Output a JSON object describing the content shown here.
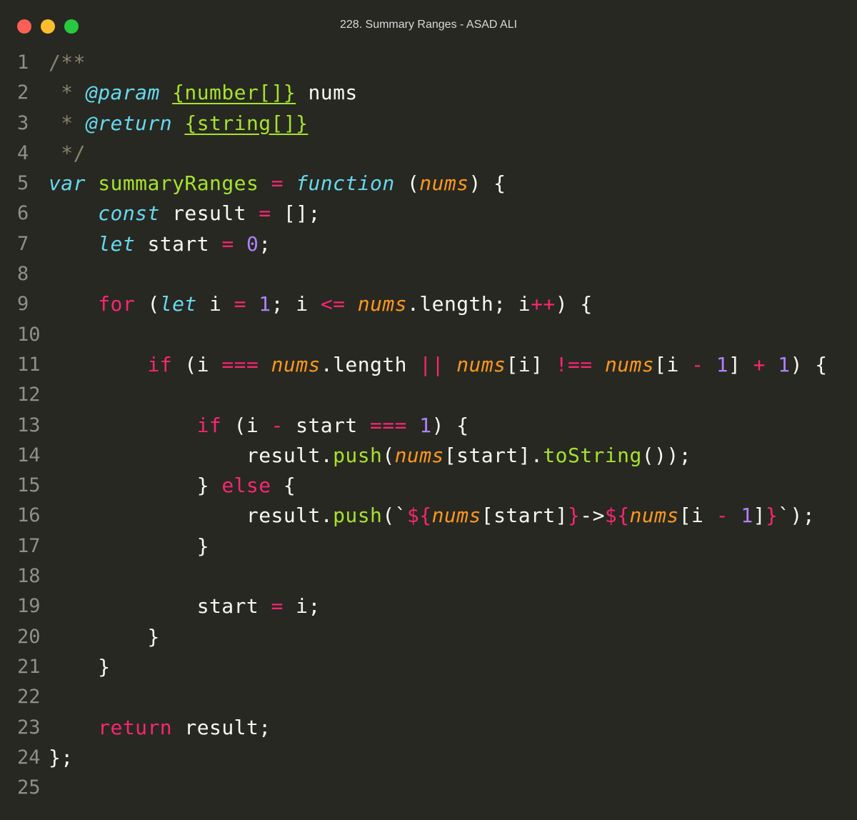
{
  "window": {
    "title": "228. Summary Ranges - ASAD ALI",
    "controls": [
      "close",
      "minimize",
      "maximize"
    ]
  },
  "colors": {
    "background": "#272822",
    "close": "#ff5f56",
    "minimize": "#ffbd2e",
    "maximize": "#27c93f"
  },
  "editor": {
    "language": "javascript",
    "lines": [
      {
        "n": "1",
        "tokens": [
          [
            "comment",
            "/**"
          ]
        ]
      },
      {
        "n": "2",
        "tokens": [
          [
            "comment",
            " * "
          ],
          [
            "tag",
            "@param"
          ],
          [
            "plain",
            " "
          ],
          [
            "type",
            "{number[]}"
          ],
          [
            "plain",
            " nums"
          ]
        ]
      },
      {
        "n": "3",
        "tokens": [
          [
            "comment",
            " * "
          ],
          [
            "tag",
            "@return"
          ],
          [
            "plain",
            " "
          ],
          [
            "type",
            "{string[]}"
          ]
        ]
      },
      {
        "n": "4",
        "tokens": [
          [
            "comment",
            " */"
          ]
        ]
      },
      {
        "n": "5",
        "tokens": [
          [
            "storage",
            "var"
          ],
          [
            "plain",
            " "
          ],
          [
            "func",
            "summaryRanges"
          ],
          [
            "plain",
            " "
          ],
          [
            "op",
            "="
          ],
          [
            "plain",
            " "
          ],
          [
            "storage",
            "function"
          ],
          [
            "plain",
            " ("
          ],
          [
            "param",
            "nums"
          ],
          [
            "plain",
            ") {"
          ]
        ]
      },
      {
        "n": "6",
        "tokens": [
          [
            "plain",
            "    "
          ],
          [
            "storage",
            "const"
          ],
          [
            "plain",
            " result "
          ],
          [
            "op",
            "="
          ],
          [
            "plain",
            " [];"
          ]
        ]
      },
      {
        "n": "7",
        "tokens": [
          [
            "plain",
            "    "
          ],
          [
            "storage",
            "let"
          ],
          [
            "plain",
            " start "
          ],
          [
            "op",
            "="
          ],
          [
            "plain",
            " "
          ],
          [
            "num",
            "0"
          ],
          [
            "plain",
            ";"
          ]
        ]
      },
      {
        "n": "8",
        "tokens": []
      },
      {
        "n": "9",
        "tokens": [
          [
            "plain",
            "    "
          ],
          [
            "kw",
            "for"
          ],
          [
            "plain",
            " ("
          ],
          [
            "storage",
            "let"
          ],
          [
            "plain",
            " i "
          ],
          [
            "op",
            "="
          ],
          [
            "plain",
            " "
          ],
          [
            "num",
            "1"
          ],
          [
            "plain",
            "; i "
          ],
          [
            "op",
            "<="
          ],
          [
            "plain",
            " "
          ],
          [
            "param",
            "nums"
          ],
          [
            "plain",
            ".length; i"
          ],
          [
            "op",
            "++"
          ],
          [
            "plain",
            ") {"
          ]
        ]
      },
      {
        "n": "10",
        "tokens": []
      },
      {
        "n": "11",
        "tokens": [
          [
            "plain",
            "        "
          ],
          [
            "kw",
            "if"
          ],
          [
            "plain",
            " (i "
          ],
          [
            "op",
            "==="
          ],
          [
            "plain",
            " "
          ],
          [
            "param",
            "nums"
          ],
          [
            "plain",
            ".length "
          ],
          [
            "op",
            "||"
          ],
          [
            "plain",
            " "
          ],
          [
            "param",
            "nums"
          ],
          [
            "plain",
            "[i] "
          ],
          [
            "op",
            "!=="
          ],
          [
            "plain",
            " "
          ],
          [
            "param",
            "nums"
          ],
          [
            "plain",
            "[i "
          ],
          [
            "op",
            "-"
          ],
          [
            "plain",
            " "
          ],
          [
            "num",
            "1"
          ],
          [
            "plain",
            "] "
          ],
          [
            "op",
            "+"
          ],
          [
            "plain",
            " "
          ],
          [
            "num",
            "1"
          ],
          [
            "plain",
            ") {"
          ]
        ]
      },
      {
        "n": "12",
        "tokens": []
      },
      {
        "n": "13",
        "tokens": [
          [
            "plain",
            "            "
          ],
          [
            "kw",
            "if"
          ],
          [
            "plain",
            " (i "
          ],
          [
            "op",
            "-"
          ],
          [
            "plain",
            " start "
          ],
          [
            "op",
            "==="
          ],
          [
            "plain",
            " "
          ],
          [
            "num",
            "1"
          ],
          [
            "plain",
            ") {"
          ]
        ]
      },
      {
        "n": "14",
        "tokens": [
          [
            "plain",
            "                result."
          ],
          [
            "func",
            "push"
          ],
          [
            "plain",
            "("
          ],
          [
            "param",
            "nums"
          ],
          [
            "plain",
            "[start]."
          ],
          [
            "func",
            "toString"
          ],
          [
            "plain",
            "());"
          ]
        ]
      },
      {
        "n": "15",
        "tokens": [
          [
            "plain",
            "            } "
          ],
          [
            "kw",
            "else"
          ],
          [
            "plain",
            " {"
          ]
        ]
      },
      {
        "n": "16",
        "tokens": [
          [
            "plain",
            "                result."
          ],
          [
            "func",
            "push"
          ],
          [
            "plain",
            "(`"
          ],
          [
            "op",
            "${"
          ],
          [
            "param",
            "nums"
          ],
          [
            "plain",
            "[start]"
          ],
          [
            "op",
            "}"
          ],
          [
            "plain",
            "->"
          ],
          [
            "op",
            "${"
          ],
          [
            "param",
            "nums"
          ],
          [
            "plain",
            "[i "
          ],
          [
            "op",
            "-"
          ],
          [
            "plain",
            " "
          ],
          [
            "num",
            "1"
          ],
          [
            "plain",
            "]"
          ],
          [
            "op",
            "}"
          ],
          [
            "plain",
            "`);"
          ]
        ]
      },
      {
        "n": "17",
        "tokens": [
          [
            "plain",
            "            }"
          ]
        ]
      },
      {
        "n": "18",
        "tokens": []
      },
      {
        "n": "19",
        "tokens": [
          [
            "plain",
            "            start "
          ],
          [
            "op",
            "="
          ],
          [
            "plain",
            " i;"
          ]
        ]
      },
      {
        "n": "20",
        "tokens": [
          [
            "plain",
            "        }"
          ]
        ]
      },
      {
        "n": "21",
        "tokens": [
          [
            "plain",
            "    }"
          ]
        ]
      },
      {
        "n": "22",
        "tokens": []
      },
      {
        "n": "23",
        "tokens": [
          [
            "plain",
            "    "
          ],
          [
            "kw",
            "return"
          ],
          [
            "plain",
            " result;"
          ]
        ]
      },
      {
        "n": "24",
        "tokens": [
          [
            "plain",
            "};"
          ]
        ]
      },
      {
        "n": "25",
        "tokens": []
      }
    ]
  }
}
